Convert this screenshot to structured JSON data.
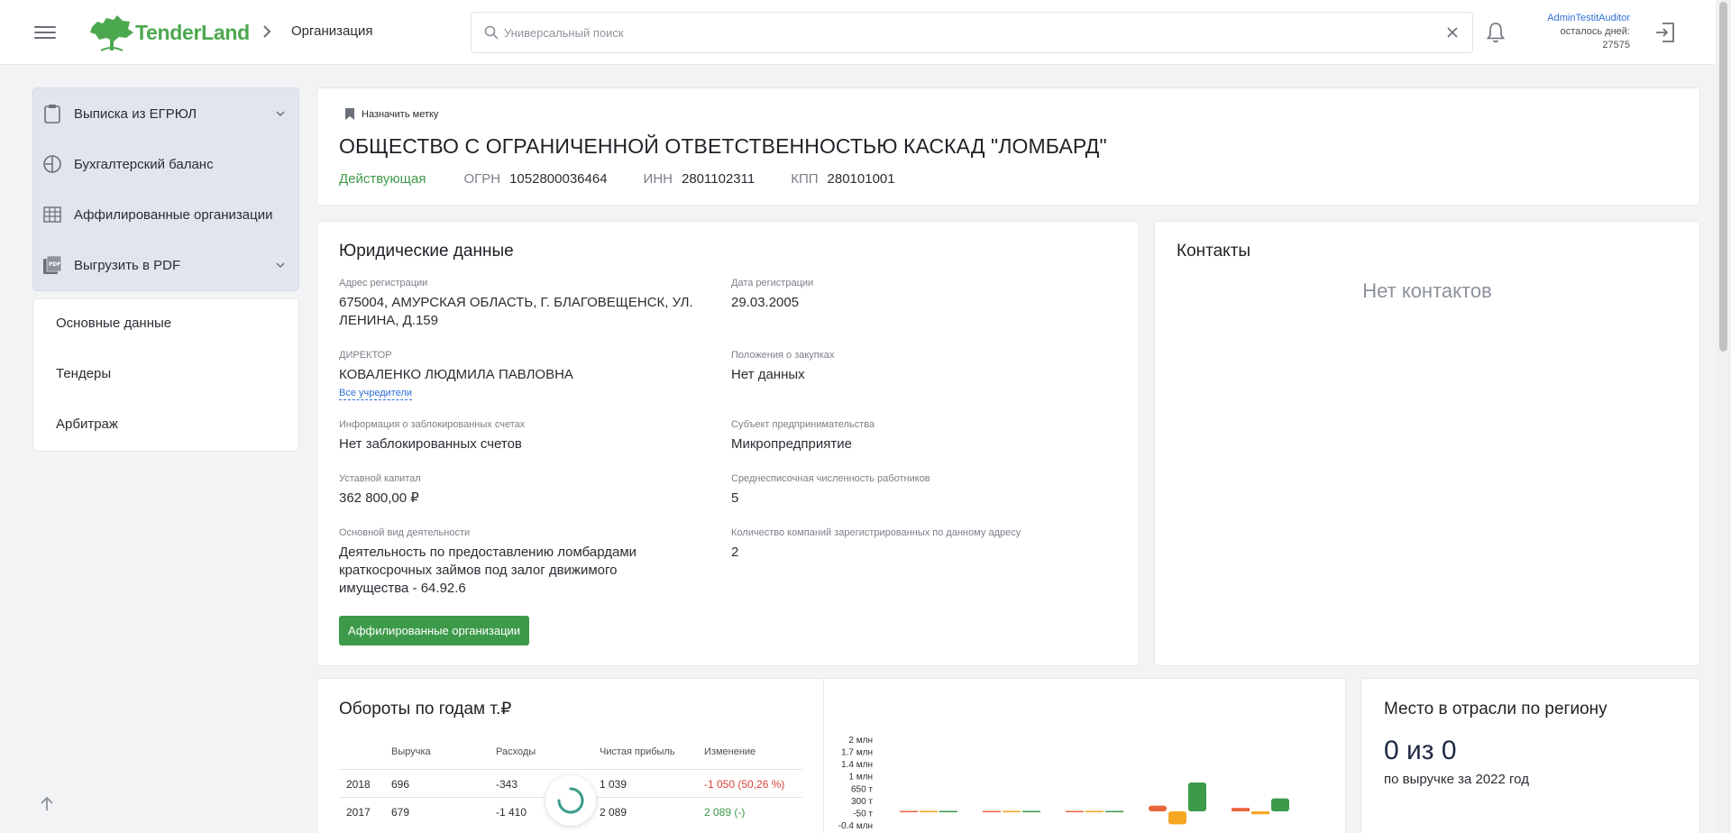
{
  "header": {
    "logo_text": "TenderLand",
    "breadcrumb": "Организация",
    "search_placeholder": "Универсальный поиск",
    "user_name": "AdminTestitAuditor",
    "days_label": "осталось дней:",
    "days_value": "27575"
  },
  "sidebar": {
    "actions": [
      {
        "label": "Выписка из ЕГРЮЛ",
        "icon": "clipboard-icon",
        "has_dropdown": true
      },
      {
        "label": "Бухгалтерский баланс",
        "icon": "pie-chart-icon",
        "has_dropdown": false
      },
      {
        "label": "Аффилированные организации",
        "icon": "grid-table-icon",
        "has_dropdown": false
      },
      {
        "label": "Выгрузить в PDF",
        "icon": "pdf-icon",
        "has_dropdown": true
      }
    ],
    "nav": [
      {
        "label": "Основные данные"
      },
      {
        "label": "Тендеры"
      },
      {
        "label": "Арбитраж"
      }
    ]
  },
  "org": {
    "tag_button": "Назначить метку",
    "title": "ОБЩЕСТВО С ОГРАНИЧЕННОЙ ОТВЕТСТВЕННОСТЬЮ КАСКАД \"ЛОМБАРД\"",
    "status": "Действующая",
    "ogrn_label": "ОГРН",
    "ogrn": "1052800036464",
    "inn_label": "ИНН",
    "inn": "2801102311",
    "kpp_label": "КПП",
    "kpp": "280101001",
    "status_color": "#3f9a4a"
  },
  "legal": {
    "title": "Юридические данные",
    "address_label": "Адрес регистрации",
    "address_line1": "675004, АМУРСКАЯ ОБЛАСТЬ, Г. БЛАГОВЕЩЕНСК, УЛ.",
    "address_line2": "ЛЕНИНА, Д.159",
    "reg_date_label": "Дата регистрации",
    "reg_date": "29.03.2005",
    "director_label": "ДИРЕКТОР",
    "director": "КОВАЛЕНКО ЛЮДМИЛА ПАВЛОВНА",
    "founders_link": "Все учредители",
    "procurement_label": "Положения о закупках",
    "procurement": "Нет данных",
    "blocked_label": "Информация о заблокированных счетах",
    "blocked": "Нет заблокированных счетов",
    "subject_label": "Субъект предпринимательства",
    "subject": "Микропредприятие",
    "capital_label": "Уставной капитал",
    "capital": "362 800,00 ₽",
    "employees_label": "Среднесписочная численность работников",
    "employees": "5",
    "activity_label": "Основной вид деятельности",
    "activity_line1": "Деятельность по предоставлению ломбардами",
    "activity_line2": "краткосрочных займов под залог движимого",
    "activity_line3": "имущества - 64.92.6",
    "same_address_label": "Количество компаний зарегистрированных по данному адресу",
    "same_address": "2",
    "affiliated_button": "Аффилированные организации"
  },
  "contacts": {
    "title": "Контакты",
    "empty": "Нет контактов"
  },
  "turnover": {
    "title": "Обороты по годам т.₽",
    "columns": [
      "Выручка",
      "Расходы",
      "Чистая прибыль",
      "Изменение"
    ],
    "rows": [
      {
        "year": "2018",
        "revenue": "696",
        "expenses": "-343",
        "profit": "1 039",
        "change": "-1 050 (50,26 %)",
        "change_sign": "neg"
      },
      {
        "year": "2017",
        "revenue": "679",
        "expenses": "-1 410",
        "profit": "2 089",
        "change": "2 089 (-)",
        "change_sign": "pos"
      }
    ]
  },
  "chart_data": {
    "type": "bar",
    "y_ticks": [
      "2 млн",
      "1.7 млн",
      "1.4 млн",
      "1 млн",
      "650 т",
      "300 т",
      "-50 т",
      "-0.4 млн"
    ],
    "categories": [
      "",
      "",
      "",
      "",
      ""
    ],
    "series": [
      {
        "color": "#e8663d",
        "values": [
          0,
          0,
          0,
          0.2,
          0.12
        ]
      },
      {
        "color": "#f5a623",
        "values": [
          0,
          0,
          0,
          -0.45,
          -0.1
        ]
      },
      {
        "color": "#3d9a4a",
        "values": [
          0,
          0,
          0,
          1.0,
          0.45
        ]
      }
    ],
    "colors": {
      "revenue": "#e8663d",
      "expenses": "#f5a623",
      "profit": "#3d9a4a"
    }
  },
  "rank": {
    "title": "Место в отрасли по региону",
    "value": "0 из 0",
    "subtitle": "по выручке за 2022 год"
  }
}
